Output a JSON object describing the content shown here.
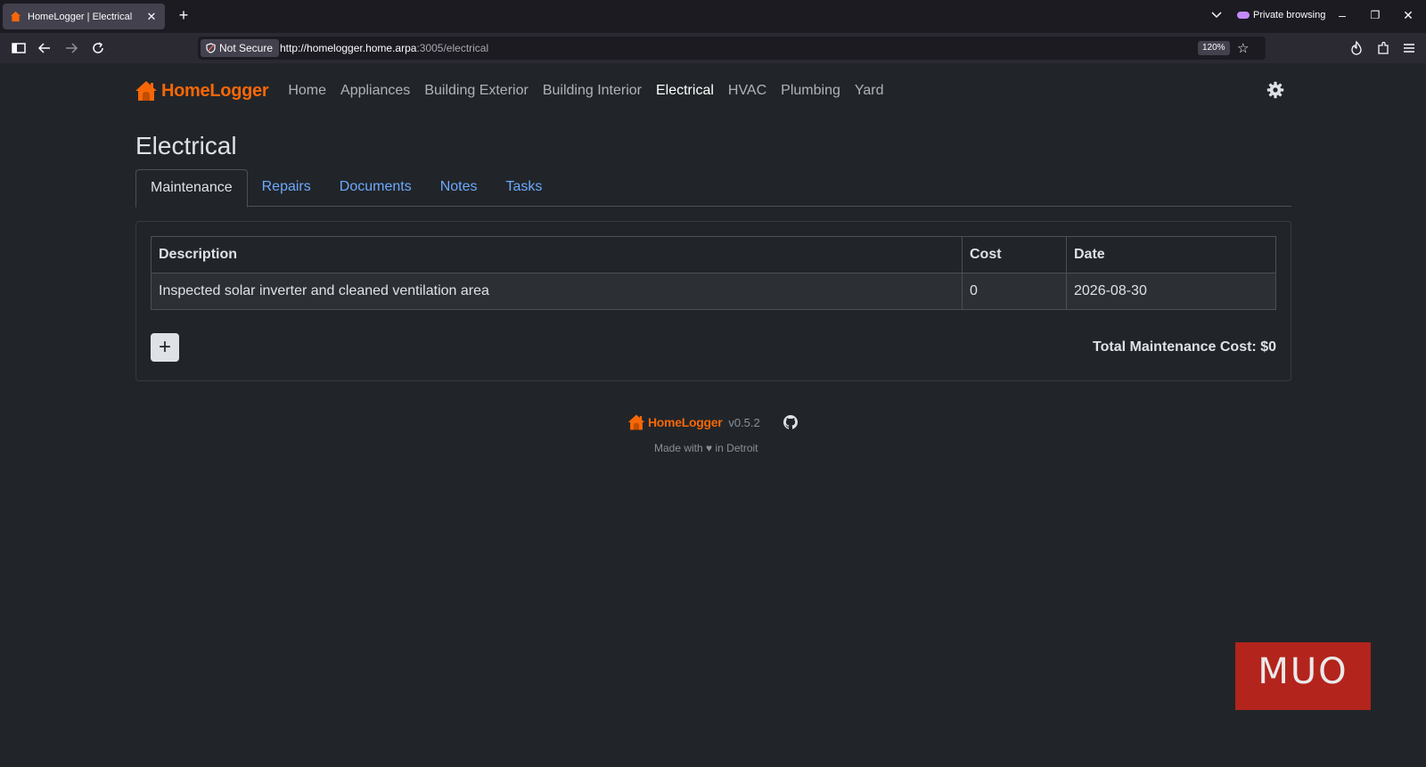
{
  "browser": {
    "tab_title": "HomeLogger | Electrical",
    "private_label": "Private browsing",
    "not_secure_label": "Not Secure",
    "url_host": "http://homelogger.home.arpa",
    "url_path": ":3005/electrical",
    "zoom": "120%"
  },
  "app": {
    "brand": "HomeLogger",
    "brand_color": "#f76707",
    "nav": [
      {
        "label": "Home",
        "active": false
      },
      {
        "label": "Appliances",
        "active": false
      },
      {
        "label": "Building Exterior",
        "active": false
      },
      {
        "label": "Building Interior",
        "active": false
      },
      {
        "label": "Electrical",
        "active": true
      },
      {
        "label": "HVAC",
        "active": false
      },
      {
        "label": "Plumbing",
        "active": false
      },
      {
        "label": "Yard",
        "active": false
      }
    ],
    "settings_icon": "gear-icon"
  },
  "page": {
    "title": "Electrical",
    "tabs": [
      {
        "label": "Maintenance",
        "active": true
      },
      {
        "label": "Repairs",
        "active": false
      },
      {
        "label": "Documents",
        "active": false
      },
      {
        "label": "Notes",
        "active": false
      },
      {
        "label": "Tasks",
        "active": false
      }
    ]
  },
  "table": {
    "columns": [
      "Description",
      "Cost",
      "Date"
    ],
    "rows": [
      {
        "description": "Inspected solar inverter and cleaned ventilation area",
        "cost": "0",
        "date": "2026-08-30"
      }
    ]
  },
  "add_button_label": "+",
  "total_label": "Total Maintenance Cost: $0",
  "footer": {
    "brand": "HomeLogger",
    "version": "v0.5.2",
    "made_with": "Made with ♥ in Detroit"
  },
  "watermark": "MUO"
}
